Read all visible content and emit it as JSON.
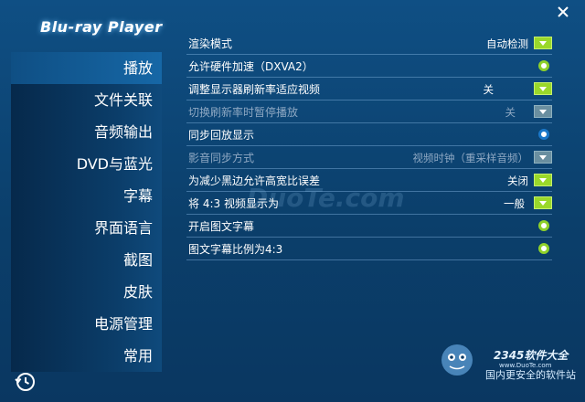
{
  "app": {
    "logo": "Blu-ray Player"
  },
  "watermark": {
    "center": "DuoTe.com",
    "brand": "2345软件大全",
    "domain": "www.DuoTe.com",
    "tagline": "国内更安全的软件站"
  },
  "sidebar": {
    "items": [
      {
        "label": "播放",
        "active": true
      },
      {
        "label": "文件关联"
      },
      {
        "label": "音频输出"
      },
      {
        "label": "DVD与蓝光"
      },
      {
        "label": "字幕"
      },
      {
        "label": "界面语言"
      },
      {
        "label": "截图"
      },
      {
        "label": "皮肤"
      },
      {
        "label": "电源管理"
      },
      {
        "label": "常用"
      }
    ]
  },
  "settings": {
    "rows": [
      {
        "label": "渲染模式",
        "value": "自动检测",
        "control": "dropdown"
      },
      {
        "label": "允许硬件加速（DXVA2）",
        "control": "toggle-green"
      },
      {
        "label": "调整显示器刷新率适应视频",
        "value": "关",
        "control": "dropdown"
      },
      {
        "label": "切换刷新率时暂停播放",
        "value": "关",
        "control": "dropdown",
        "disabled": true
      },
      {
        "label": "同步回放显示",
        "control": "toggle-blue"
      },
      {
        "label": "影音同步方式",
        "value": "视频时钟（重采样音频）",
        "control": "dropdown",
        "disabled": true
      },
      {
        "label": "为减少黑边允许高宽比误差",
        "value": "关闭",
        "control": "dropdown"
      },
      {
        "label": "将 4:3 视频显示为",
        "value": "一般",
        "control": "dropdown"
      },
      {
        "label": "开启图文字幕",
        "control": "toggle-green"
      },
      {
        "label": "图文字幕比例为4:3",
        "control": "toggle-green"
      }
    ]
  },
  "colors": {
    "accent_green": "#9ad82a",
    "toggle_blue": "#1a77c8",
    "window_bg": "#0f4f84"
  }
}
